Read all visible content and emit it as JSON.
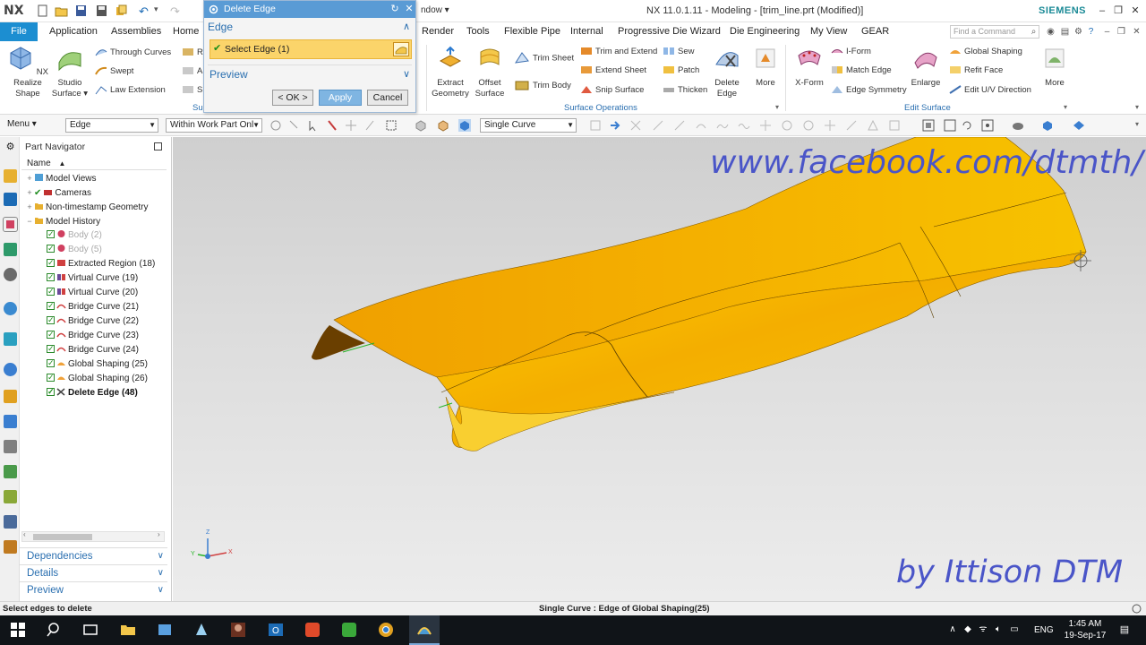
{
  "app": {
    "logo": "NX",
    "window_title": "NX 11.0.1.11 - Modeling - [trim_line.prt (Modified)]",
    "brand": "SIEMENS",
    "window_menu": "ndow ▾"
  },
  "tabs": {
    "file": "File",
    "items": [
      "Application",
      "Assemblies",
      "Home",
      "Render",
      "Tools",
      "Flexible Pipe",
      "Internal",
      "Progressive Die Wizard",
      "Die Engineering",
      "My View",
      "GEAR"
    ],
    "search_placeholder": "Find a Command"
  },
  "ribbon": {
    "nx_realize_shape": "NX Realize Shape",
    "studio_surface": "Studio Surface ▾",
    "through_curves": "Through Curves",
    "swept": "Swept",
    "law_extension": "Law Extension",
    "extract_geometry": "Extract Geometry",
    "offset_surface": "Offset Surface",
    "trim_sheet": "Trim Sheet",
    "trim_body": "Trim Body",
    "trim_and_extend": "Trim and Extend",
    "extend_sheet": "Extend Sheet",
    "snip_surface": "Snip Surface",
    "sew": "Sew",
    "patch": "Patch",
    "thicken": "Thicken",
    "delete_edge": "Delete Edge",
    "more_1": "More",
    "surface_operations": "Surface Operations",
    "x_form": "X-Form",
    "i_form": "I-Form",
    "match_edge": "Match Edge",
    "edge_symmetry": "Edge Symmetry",
    "enlarge": "Enlarge",
    "global_shaping": "Global Shaping",
    "refit_face": "Refit Face",
    "edit_uv_direction": "Edit U/V Direction",
    "more_2": "More",
    "edit_surface": "Edit Surface",
    "partial_label_su": "Su",
    "partial_r": "R",
    "partial_a": "A",
    "partial_s": "S"
  },
  "toolbar": {
    "menu": "Menu ▾",
    "selection_filter": "Edge",
    "scope": "Within Work Part Onl",
    "curve_rule": "Single Curve"
  },
  "navigator": {
    "title": "Part Navigator",
    "column_name": "Name",
    "rows": [
      {
        "label": "Model Views"
      },
      {
        "label": "Cameras"
      },
      {
        "label": "Non-timestamp Geometry"
      },
      {
        "label": "Model History"
      },
      {
        "label": "Body (2)"
      },
      {
        "label": "Body (5)"
      },
      {
        "label": "Extracted Region (18)"
      },
      {
        "label": "Virtual Curve (19)"
      },
      {
        "label": "Virtual Curve (20)"
      },
      {
        "label": "Bridge Curve (21)"
      },
      {
        "label": "Bridge Curve (22)"
      },
      {
        "label": "Bridge Curve (23)"
      },
      {
        "label": "Bridge Curve (24)"
      },
      {
        "label": "Global Shaping (25)"
      },
      {
        "label": "Global Shaping (26)"
      },
      {
        "label": "Delete Edge (48)"
      }
    ],
    "panels": {
      "dependencies": "Dependencies",
      "details": "Details",
      "preview": "Preview"
    }
  },
  "dialog": {
    "title": "Delete Edge",
    "edge_group": "Edge",
    "select_edge": "Select Edge (1)",
    "preview_group": "Preview",
    "ok": "< OK >",
    "apply": "Apply",
    "cancel": "Cancel"
  },
  "graphics": {
    "watermark_url": "www.facebook.com/dtmth/",
    "watermark_credit": "by Ittison DTM",
    "triad_x": "X",
    "triad_y": "Y",
    "triad_z": "Z"
  },
  "status": {
    "prompt": "Select edges to delete",
    "selection_info": "Single Curve : Edge of Global Shaping(25)"
  },
  "taskbar": {
    "language": "ENG",
    "time": "1:45 AM",
    "date": "19-Sep-17"
  },
  "colors": {
    "accent_blue": "#1c8ed1",
    "title_blue": "#5a9bd5",
    "surface_orange": "#f3a800",
    "watermark": "#4a55c8",
    "selection_yellow": "#fbd46a"
  }
}
